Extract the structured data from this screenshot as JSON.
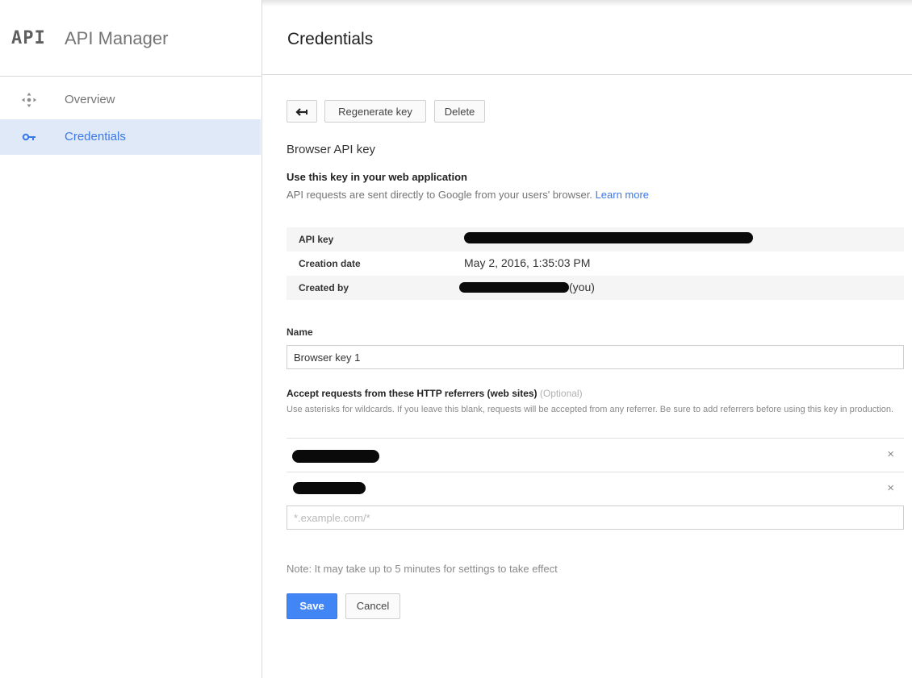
{
  "app": {
    "logo_text": "API",
    "title": "API Manager"
  },
  "sidebar": {
    "items": [
      {
        "label": "Overview",
        "icon": "overview-icon",
        "active": false
      },
      {
        "label": "Credentials",
        "icon": "key-icon",
        "active": true
      }
    ]
  },
  "header": {
    "title": "Credentials"
  },
  "toolbar": {
    "back_icon": "back-arrow-icon",
    "regenerate_label": "Regenerate key",
    "delete_label": "Delete"
  },
  "key": {
    "type": "Browser API key",
    "use_heading": "Use this key in your web application",
    "use_description": "API requests are sent directly to Google from your users' browser.",
    "learn_more": "Learn more"
  },
  "details": {
    "api_key_label": "API key",
    "creation_date_label": "Creation date",
    "creation_date_value": "May 2, 2016, 1:35:03 PM",
    "created_by_label": "Created by",
    "created_by_suffix": "(you)"
  },
  "name_field": {
    "label": "Name",
    "value": "Browser key 1"
  },
  "referrers": {
    "heading": "Accept requests from these HTTP referrers (web sites)",
    "optional": "(Optional)",
    "description": "Use asterisks for wildcards. If you leave this blank, requests will be accepted from any referrer. Be sure to add referrers before using this key in production.",
    "remove_icon": "×",
    "new_placeholder": "*.example.com/*"
  },
  "note": "Note: It may take up to 5 minutes for settings to take effect",
  "actions": {
    "save_label": "Save",
    "cancel_label": "Cancel"
  },
  "colors": {
    "accent": "#4285f4",
    "active_nav_bg": "#dfe9f7",
    "link": "#3b78e7"
  }
}
